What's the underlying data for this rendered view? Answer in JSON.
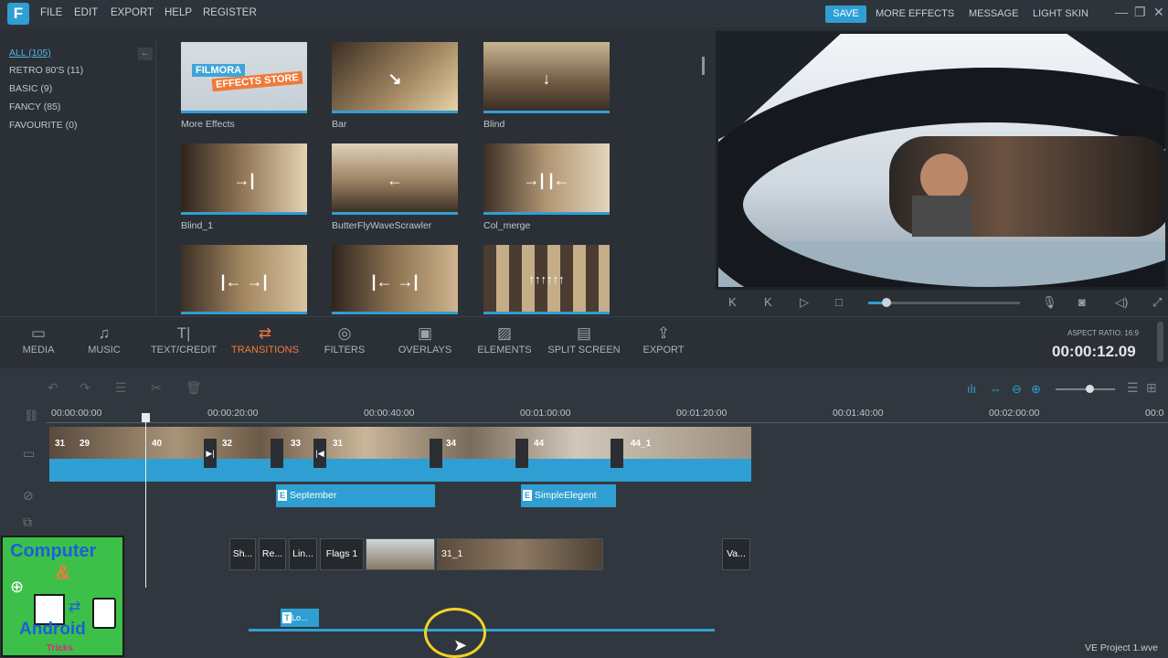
{
  "menubar": {
    "app_icon": "F",
    "items": [
      "FILE",
      "EDIT",
      "EXPORT",
      "HELP",
      "REGISTER"
    ],
    "save_label": "SAVE",
    "right_items": [
      "MORE EFFECTS",
      "MESSAGE",
      "LIGHT SKIN"
    ],
    "window_controls": [
      "minimize-icon",
      "maximize-icon",
      "close-icon"
    ]
  },
  "categories": [
    "ALL (105)",
    "RETRO 80'S (11)",
    "BASIC (9)",
    "FANCY (85)",
    "FAVOURITE (0)"
  ],
  "store": {
    "line1": "FILMORA",
    "line2": "EFFECTS STORE"
  },
  "effects": [
    {
      "label": "More Effects",
      "arrows": ""
    },
    {
      "label": "Bar",
      "arrows": "↘"
    },
    {
      "label": "Blind",
      "arrows": "↓"
    },
    {
      "label": "Blind_1",
      "arrows": "→|"
    },
    {
      "label": "ButterFlyWaveScrawler",
      "arrows": "←"
    },
    {
      "label": "Col_merge",
      "arrows": "→| |←"
    },
    {
      "label": "",
      "arrows": "|← →|"
    },
    {
      "label": "",
      "arrows": "|← →|"
    },
    {
      "label": "",
      "arrows": "↑↑↑↑↑↑"
    }
  ],
  "toolbar": {
    "items": [
      {
        "label": "MEDIA",
        "icon": "folder-icon"
      },
      {
        "label": "MUSIC",
        "icon": "music-icon"
      },
      {
        "label": "TEXT/CREDIT",
        "icon": "text-icon"
      },
      {
        "label": "TRANSITIONS",
        "icon": "transitions-icon"
      },
      {
        "label": "FILTERS",
        "icon": "filters-icon"
      },
      {
        "label": "OVERLAYS",
        "icon": "overlays-icon"
      },
      {
        "label": "ELEMENTS",
        "icon": "elements-icon"
      },
      {
        "label": "SPLIT SCREEN",
        "icon": "split-screen-icon"
      },
      {
        "label": "EXPORT",
        "icon": "export-icon"
      }
    ],
    "active": "TRANSITIONS",
    "aspect_ratio": "ASPECT RATIO: 16:9",
    "timecode": "00:00:12.09"
  },
  "preview": {
    "progress": 0.12
  },
  "timeline": {
    "ruler": [
      "00:00:00:00",
      "00:00:20:00",
      "00:00:40:00",
      "00:01:00:00",
      "00:01:20:00",
      "00:01:40:00",
      "00:02:00:00",
      "00:0"
    ],
    "clip_numbers": [
      "31",
      "29",
      "40",
      "32",
      "33",
      "31",
      "34",
      "44",
      "44_1"
    ],
    "effects_track": [
      "September",
      "SimpleElegent"
    ],
    "pip_track": [
      "Sh...",
      "Re...",
      "Lin...",
      "Flags 1",
      "",
      "31_1",
      "Va..."
    ],
    "title_clip": "Lo...",
    "project_name": "VE Project 1.wve"
  },
  "watermark": {
    "line1": "Computer",
    "line2": "&",
    "line3": "Android",
    "line4": "Tricks"
  },
  "colors": {
    "accent": "#2f9fd3",
    "active_tool": "#f07a3a",
    "background": "#2b3036"
  }
}
